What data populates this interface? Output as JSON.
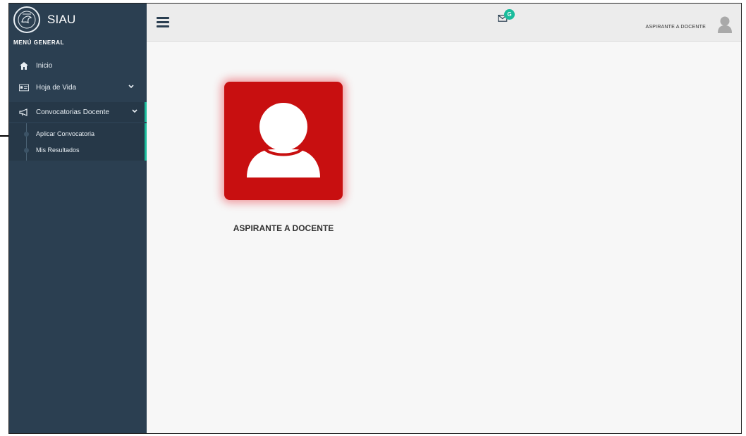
{
  "brand": {
    "name": "SIAU",
    "logo_icon": "university-seal-icon"
  },
  "sidebar": {
    "menu_title": "MENÚ GENERAL",
    "items": [
      {
        "label": "Inicio",
        "icon": "home-icon"
      },
      {
        "label": "Hoja de Vida",
        "icon": "id-card-icon",
        "has_chevron": true
      },
      {
        "label": "Convocatorias Docente",
        "icon": "megaphone-icon",
        "has_chevron": true,
        "active": true
      }
    ],
    "subitems": [
      {
        "label": "Aplicar Convocatoria"
      },
      {
        "label": "Mis Resultados"
      }
    ]
  },
  "topbar": {
    "notifications_badge": "G",
    "user_name": "ASPIRANTE A DOCENTE"
  },
  "main": {
    "card_label": "ASPIRANTE A DOCENTE"
  },
  "colors": {
    "sidebar_bg": "#2b3f51",
    "accent": "#1abc9c",
    "card_red": "#c80f10",
    "topbar_bg": "#ececec"
  }
}
